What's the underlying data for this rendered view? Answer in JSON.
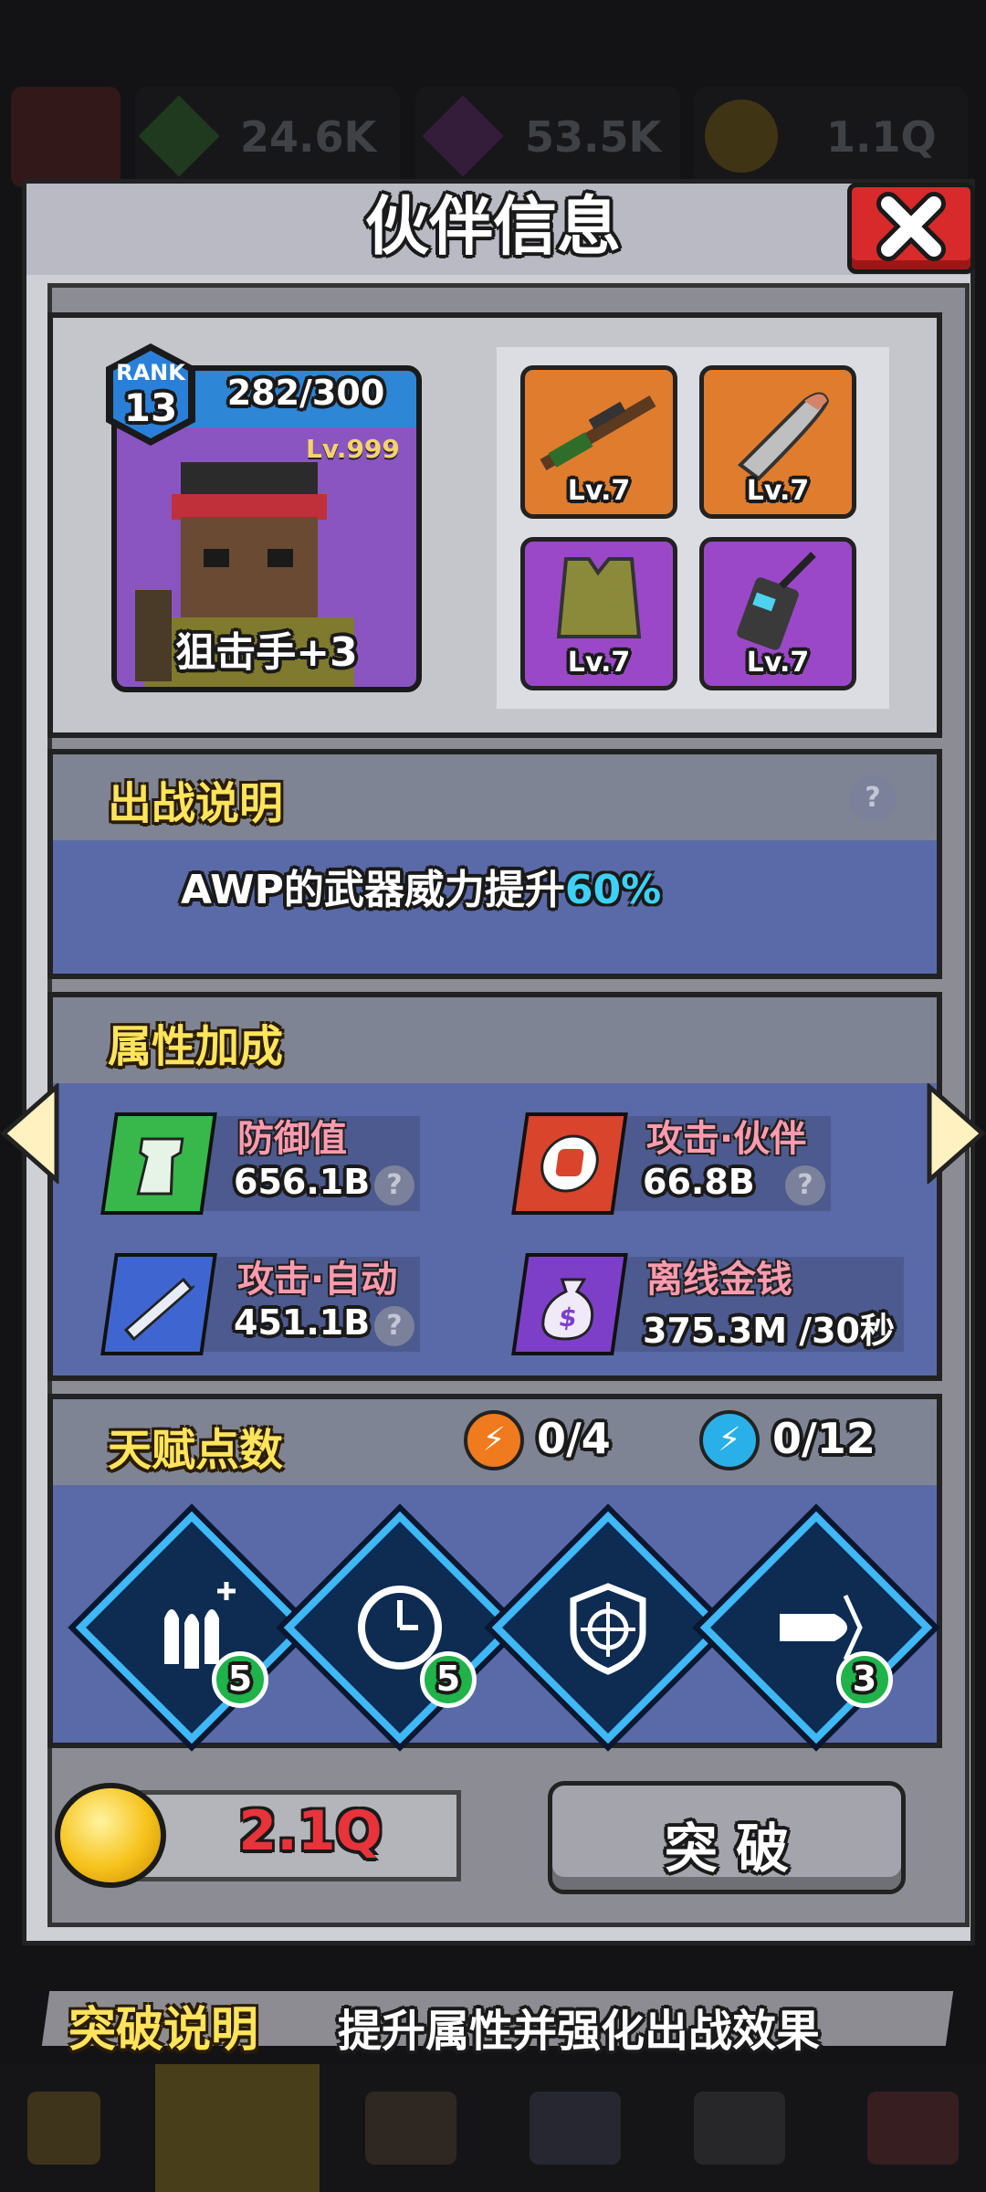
{
  "hud": {
    "green_gems": "24.6K",
    "purple_gems": "53.5K",
    "coins": "1.1Q"
  },
  "title": "伙伴信息",
  "partner": {
    "rank_label": "RANK",
    "rank": "13",
    "progress": "282/300",
    "level": "Lv.999",
    "name": "狙击手+3"
  },
  "equipment": [
    {
      "icon": "sniper-rifle-icon",
      "level": "Lv.7"
    },
    {
      "icon": "bullet-icon",
      "level": "Lv.7"
    },
    {
      "icon": "tactical-vest-icon",
      "level": "Lv.7"
    },
    {
      "icon": "walkie-talkie-icon",
      "level": "Lv.7"
    }
  ],
  "battle": {
    "heading": "出战说明",
    "desc_prefix": "AWP的武器威力提升",
    "desc_value": "60%"
  },
  "attributes": {
    "heading": "属性加成",
    "items": [
      {
        "icon": "tower-icon",
        "label": "防御值",
        "value": "656.1B"
      },
      {
        "icon": "fist-icon",
        "label": "攻击·伙伴",
        "value": "66.8B"
      },
      {
        "icon": "auto-missile-icon",
        "label": "攻击·自动",
        "value": "451.1B"
      },
      {
        "icon": "money-bag-icon",
        "label": "离线金钱",
        "value": "375.3M /30秒"
      }
    ]
  },
  "talents": {
    "heading": "天赋点数",
    "orange_points": "0/4",
    "blue_points": "0/12",
    "nodes": [
      {
        "icon": "bullets-plus-icon",
        "level": "5"
      },
      {
        "icon": "clock-icon",
        "level": "5"
      },
      {
        "icon": "crosshair-shield-icon",
        "level": ""
      },
      {
        "icon": "fast-bullet-icon",
        "level": "3"
      }
    ]
  },
  "breakthrough": {
    "cost": "2.1Q",
    "button": "突 破",
    "info_label": "突破说明",
    "info_text": "提升属性并强化出战效果"
  },
  "colors": {
    "accent_blue": "#3fb8f5",
    "panel_blue": "#5a6aa8",
    "header_gray": "#7f8494",
    "cost_red": "#e8333b",
    "close_red": "#d82a2a"
  }
}
